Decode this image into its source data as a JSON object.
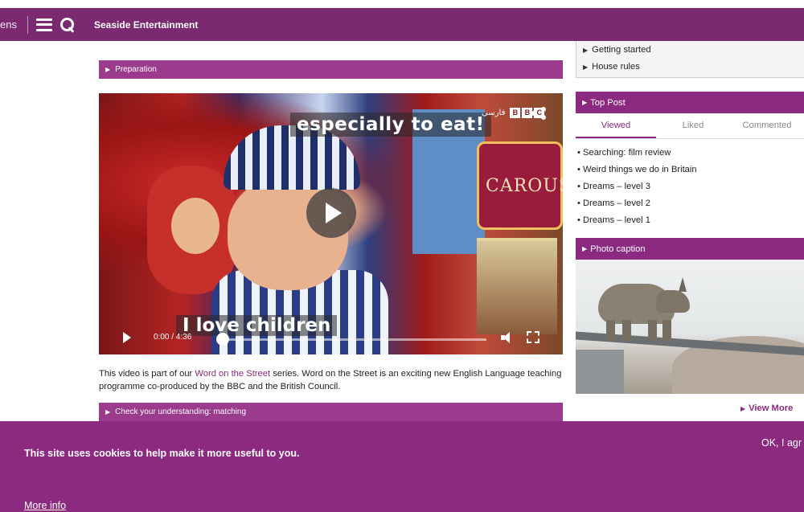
{
  "header": {
    "cut_text": "ens",
    "brand": "Seaside Entertainment",
    "bg_color": "#7b2a72"
  },
  "main": {
    "preparation_label": "Preparation",
    "video": {
      "caption_top": "especially to eat!",
      "caption_bottom": "I love children",
      "time": "0:00 / 4:36",
      "bbc_lang": "فارسی",
      "bbc_boxes": [
        "B",
        "B",
        "C"
      ]
    },
    "description": {
      "before": "This video is part of our ",
      "link": "Word on the Street",
      "after": " series. Word on the Street is an exciting new English Language teaching programme co-produced by the BBC and the British Council."
    },
    "check_label": "Check your understanding: matching"
  },
  "sidebar": {
    "links": [
      {
        "label": "Getting started"
      },
      {
        "label": "House rules"
      }
    ],
    "top_post": {
      "title": "Top Post",
      "tabs": [
        {
          "label": "Viewed"
        },
        {
          "label": "Liked"
        },
        {
          "label": "Commented"
        }
      ],
      "items": [
        {
          "label": "Searching: film review"
        },
        {
          "label": "Weird things we do in Britain"
        },
        {
          "label": "Dreams – level 3"
        },
        {
          "label": "Dreams – level 2"
        },
        {
          "label": "Dreams – level 1"
        }
      ]
    },
    "photo_caption": {
      "title": "Photo caption",
      "view_more": "View More"
    }
  },
  "cookie": {
    "message": "This site uses cookies to help make it more useful to you.",
    "more_info": "More info",
    "ok": "OK, I agr"
  },
  "colors": {
    "accent": "#8b2a80",
    "bar": "#9b3b8d"
  }
}
